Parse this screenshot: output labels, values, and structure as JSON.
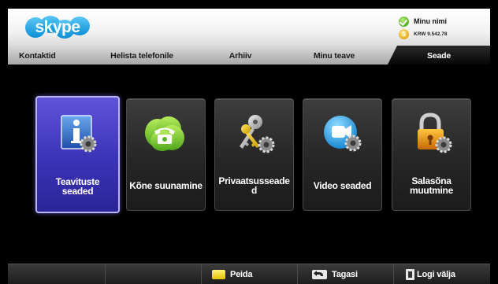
{
  "header": {
    "logo_text": "skype",
    "account": {
      "name": "Minu nimi",
      "credit": "KRW 9.542.78",
      "coin_symbol": "S",
      "status_color": "#5cb82a"
    }
  },
  "tabs": [
    {
      "label": "Kontaktid",
      "active": false
    },
    {
      "label": "Helista telefonile",
      "active": false
    },
    {
      "label": "Arhiiv",
      "active": false
    },
    {
      "label": "Minu teave",
      "active": false
    },
    {
      "label": "Seade",
      "active": true
    }
  ],
  "tiles": [
    {
      "label": "Teavituste seaded",
      "icon": "info-settings-icon",
      "selected": true
    },
    {
      "label": "Kõne suunamine",
      "icon": "phone-forward-icon",
      "selected": false
    },
    {
      "label": "Privaatsusseaded",
      "icon": "key-settings-icon",
      "selected": false
    },
    {
      "label": "Video seaded",
      "icon": "video-settings-icon",
      "selected": false
    },
    {
      "label": "Salasõna muutmine",
      "icon": "lock-settings-icon",
      "selected": false
    }
  ],
  "footer": {
    "hide": "Peida",
    "back": "Tagasi",
    "logout": "Logi välja"
  },
  "colors": {
    "accent_selected": "#3f37bd",
    "skype_blue": "#1aa0e3"
  }
}
